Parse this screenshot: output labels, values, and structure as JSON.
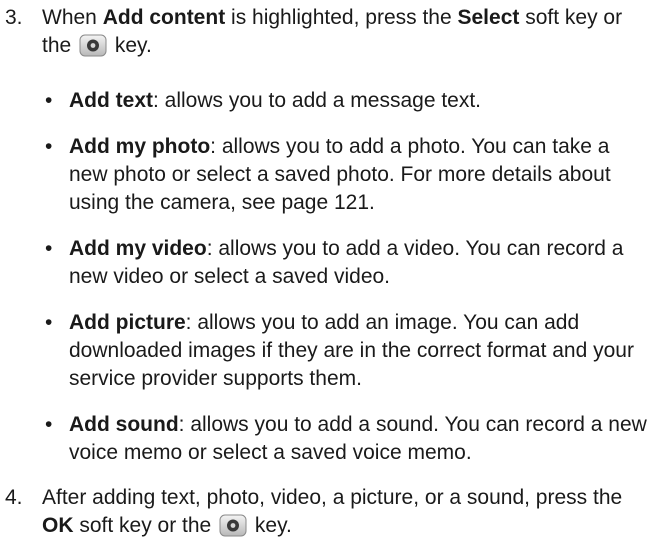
{
  "step3": {
    "number": "3.",
    "intro": "When ",
    "highlight": "Add content",
    "middle": " is highlighted, press the ",
    "softkey": "Select",
    "after_softkey": " soft key or the ",
    "key_icon": "center-key-icon",
    "end": " key."
  },
  "bullets": [
    {
      "term": "Add text",
      "desc": ": allows you to add a message text."
    },
    {
      "term": "Add my photo",
      "desc": ":  allows you to add a photo. You can take a new photo or select a saved photo. For more details about using the camera, see page 121."
    },
    {
      "term": "Add my video",
      "desc": ": allows you to add a video. You can record a new video or select a saved video."
    },
    {
      "term": "Add picture",
      "desc": ": allows you to add an image. You can add downloaded images if they are in the correct format and your service provider supports them."
    },
    {
      "term": "Add sound",
      "desc": ": allows you to add a sound. You can record a new voice memo or select a saved voice memo."
    }
  ],
  "bullet_symbol": "•",
  "step4": {
    "number": "4.",
    "intro": "After adding text, photo, video, a picture, or a sound, press the ",
    "softkey": "OK",
    "after_softkey": " soft key or the ",
    "key_icon": "center-key-icon",
    "end": " key."
  }
}
